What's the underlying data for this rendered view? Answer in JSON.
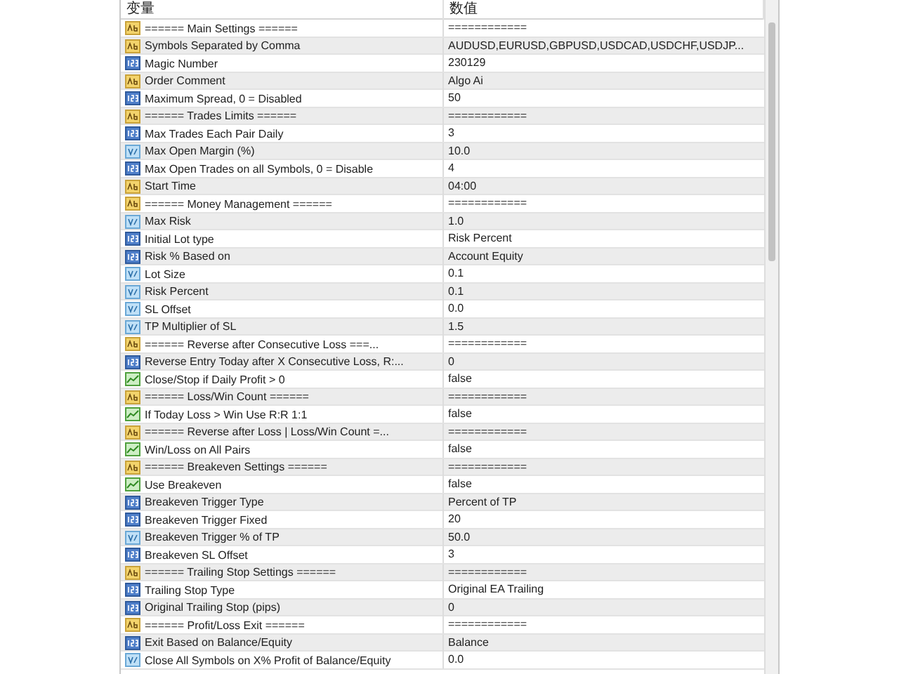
{
  "table": {
    "columns": [
      "变量",
      "数值"
    ],
    "rows": [
      {
        "kind": "string",
        "name": "====== Main Settings ======",
        "value": "============"
      },
      {
        "kind": "string",
        "name": "Symbols Separated by Comma",
        "value": "AUDUSD,EURUSD,GBPUSD,USDCAD,USDCHF,USDJP..."
      },
      {
        "kind": "int",
        "name": "Magic Number",
        "value": "230129"
      },
      {
        "kind": "string",
        "name": "Order Comment",
        "value": "Algo Ai"
      },
      {
        "kind": "int",
        "name": "Maximum Spread, 0 = Disabled",
        "value": "50"
      },
      {
        "kind": "string",
        "name": "====== Trades Limits ======",
        "value": "============"
      },
      {
        "kind": "int",
        "name": "Max Trades Each Pair Daily",
        "value": "3"
      },
      {
        "kind": "double",
        "name": "Max Open Margin (%)",
        "value": "10.0"
      },
      {
        "kind": "int",
        "name": "Max Open Trades on all Symbols, 0 = Disable",
        "value": "4"
      },
      {
        "kind": "string",
        "name": "Start Time",
        "value": "04:00"
      },
      {
        "kind": "string",
        "name": "====== Money Management ======",
        "value": "============"
      },
      {
        "kind": "double",
        "name": "Max Risk",
        "value": "1.0"
      },
      {
        "kind": "int",
        "name": "Initial Lot type",
        "value": "Risk Percent"
      },
      {
        "kind": "int",
        "name": "Risk % Based on",
        "value": "Account Equity"
      },
      {
        "kind": "double",
        "name": "Lot Size",
        "value": "0.1"
      },
      {
        "kind": "double",
        "name": "Risk Percent",
        "value": "0.1"
      },
      {
        "kind": "double",
        "name": "SL Offset",
        "value": "0.0"
      },
      {
        "kind": "double",
        "name": "TP Multiplier of SL",
        "value": "1.5"
      },
      {
        "kind": "string",
        "name": "====== Reverse after Consecutive Loss ===...",
        "value": "============"
      },
      {
        "kind": "int",
        "name": "Reverse Entry Today after X Consecutive Loss, R:...",
        "value": "0"
      },
      {
        "kind": "bool",
        "name": "Close/Stop if Daily Profit > 0",
        "value": "false"
      },
      {
        "kind": "string",
        "name": "====== Loss/Win Count ======",
        "value": "============"
      },
      {
        "kind": "bool",
        "name": "If Today Loss > Win Use R:R 1:1",
        "value": "false"
      },
      {
        "kind": "string",
        "name": "====== Reverse after Loss | Loss/Win Count =...",
        "value": "============"
      },
      {
        "kind": "bool",
        "name": "Win/Loss on All Pairs",
        "value": "false"
      },
      {
        "kind": "string",
        "name": "====== Breakeven Settings ======",
        "value": "============"
      },
      {
        "kind": "bool",
        "name": "Use Breakeven",
        "value": "false"
      },
      {
        "kind": "int",
        "name": "Breakeven Trigger Type",
        "value": "Percent of TP"
      },
      {
        "kind": "int",
        "name": "Breakeven Trigger Fixed",
        "value": "20"
      },
      {
        "kind": "double",
        "name": "Breakeven Trigger % of TP",
        "value": "50.0"
      },
      {
        "kind": "int",
        "name": "Breakeven SL Offset",
        "value": "3"
      },
      {
        "kind": "string",
        "name": "====== Trailing Stop Settings ======",
        "value": "============"
      },
      {
        "kind": "int",
        "name": "Trailing Stop Type",
        "value": "Original EA Trailing"
      },
      {
        "kind": "int",
        "name": "Original Trailing Stop (pips)",
        "value": "0"
      },
      {
        "kind": "string",
        "name": "====== Profit/Loss Exit ======",
        "value": "============"
      },
      {
        "kind": "int",
        "name": "Exit Based on Balance/Equity",
        "value": "Balance"
      },
      {
        "kind": "double",
        "name": "Close All Symbols on X% Profit of Balance/Equity",
        "value": "0.0"
      }
    ]
  }
}
